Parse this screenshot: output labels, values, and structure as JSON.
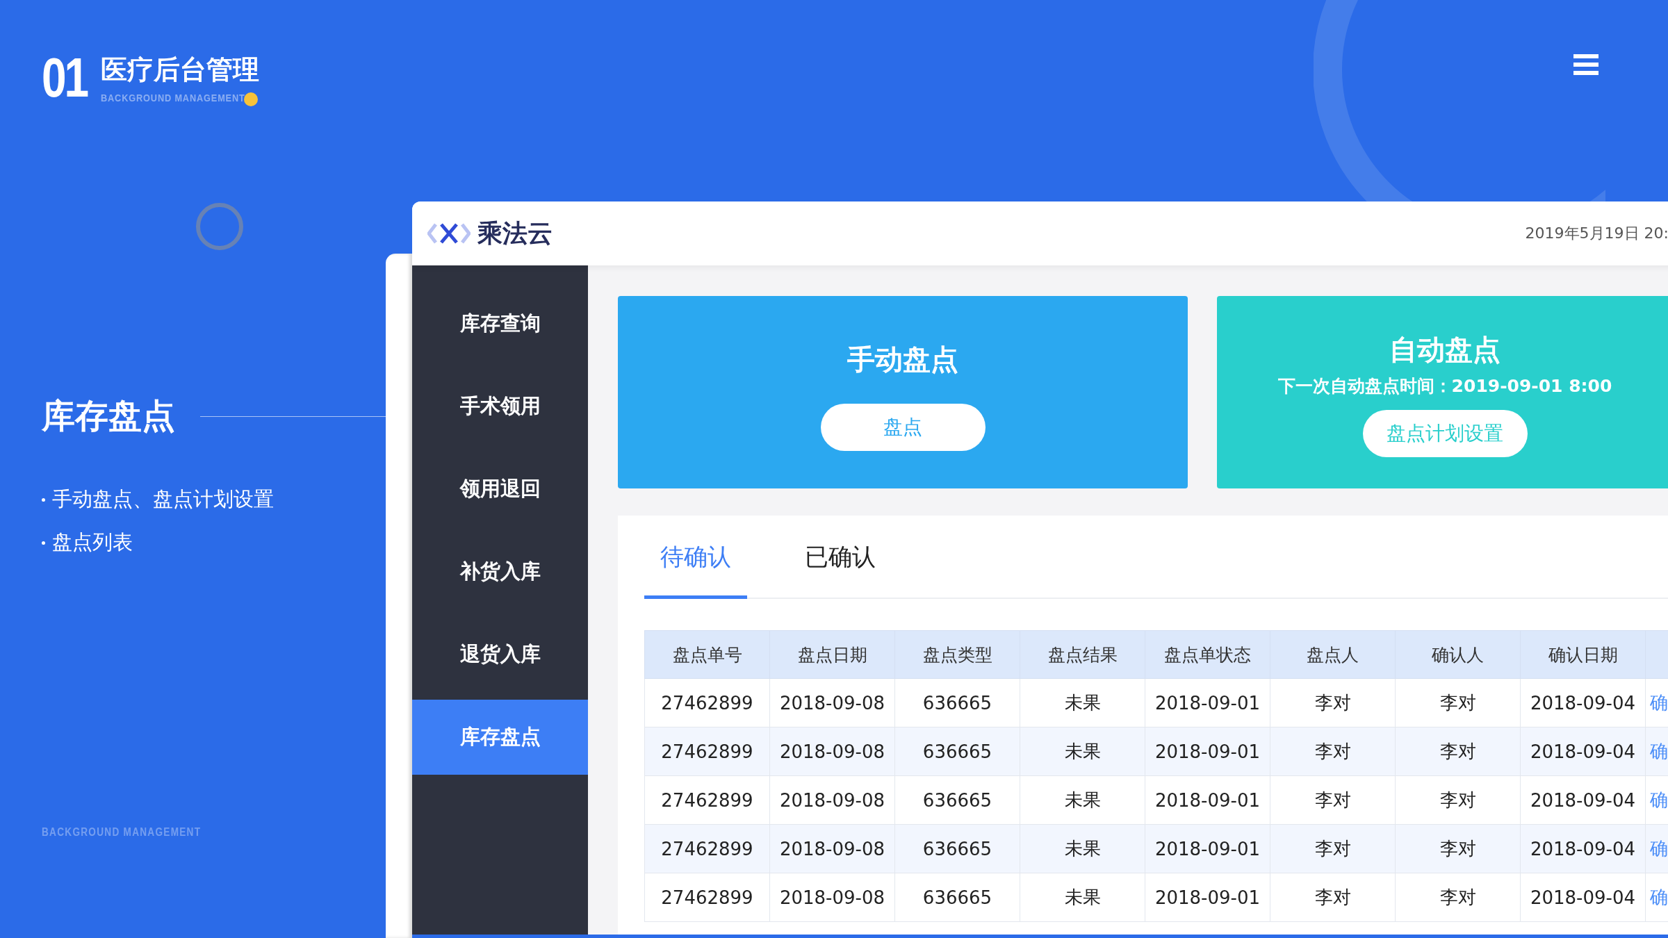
{
  "header": {
    "number": "01",
    "title": "医疗后台管理",
    "subtitle": "BACKGROUND MANAGEMENT"
  },
  "section": {
    "title": "库存盘点",
    "bullets": [
      "手动盘点、盘点计划设置",
      "盘点列表"
    ],
    "footer": "BACKGROUND MANAGEMENT"
  },
  "app": {
    "brand": "乘法云",
    "datetime": "2019年5月19日 20:",
    "sidebar": {
      "items": [
        {
          "label": "库存查询",
          "selected": false
        },
        {
          "label": "手术领用",
          "selected": false
        },
        {
          "label": "领用退回",
          "selected": false
        },
        {
          "label": "补货入库",
          "selected": false
        },
        {
          "label": "退货入库",
          "selected": false
        },
        {
          "label": "库存盘点",
          "selected": true
        }
      ]
    },
    "cards": [
      {
        "kind": "manual",
        "title": "手动盘点",
        "button": "盘点",
        "color": "#2ba8f0"
      },
      {
        "kind": "auto",
        "title": "自动盘点",
        "subtitle": "下一次自动盘点时间：2019-09-01 8:00",
        "button": "盘点计划设置",
        "color": "#29cfcc"
      }
    ],
    "tabs": [
      {
        "label": "待确认",
        "selected": true
      },
      {
        "label": "已确认",
        "selected": false
      }
    ],
    "table": {
      "columns": [
        "盘点单号",
        "盘点日期",
        "盘点类型",
        "盘点结果",
        "盘点单状态",
        "盘点人",
        "确认人",
        "确认日期",
        ""
      ],
      "rows": [
        [
          "27462899",
          "2018-09-08",
          "636665",
          "未果",
          "2018-09-01",
          "李对",
          "李对",
          "2018-09-04",
          "确"
        ],
        [
          "27462899",
          "2018-09-08",
          "636665",
          "未果",
          "2018-09-01",
          "李对",
          "李对",
          "2018-09-04",
          "确"
        ],
        [
          "27462899",
          "2018-09-08",
          "636665",
          "未果",
          "2018-09-01",
          "李对",
          "李对",
          "2018-09-04",
          "确"
        ],
        [
          "27462899",
          "2018-09-08",
          "636665",
          "未果",
          "2018-09-01",
          "李对",
          "李对",
          "2018-09-04",
          "确"
        ],
        [
          "27462899",
          "2018-09-08",
          "636665",
          "未果",
          "2018-09-01",
          "李对",
          "李对",
          "2018-09-04",
          "确"
        ]
      ]
    }
  }
}
